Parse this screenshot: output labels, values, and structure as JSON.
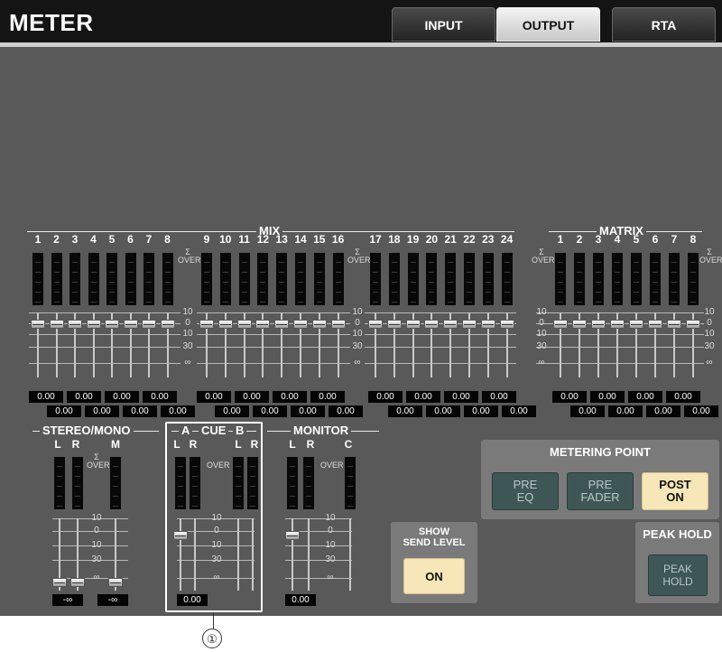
{
  "window": {
    "title": "METER"
  },
  "tabs": [
    {
      "label": "INPUT",
      "active": false
    },
    {
      "label": "OUTPUT",
      "active": true
    },
    {
      "label": "RTA",
      "active": false
    }
  ],
  "mix": {
    "title": "MIX",
    "channels": [
      "1",
      "2",
      "3",
      "4",
      "5",
      "6",
      "7",
      "8",
      "9",
      "10",
      "11",
      "12",
      "13",
      "14",
      "15",
      "16",
      "17",
      "18",
      "19",
      "20",
      "21",
      "22",
      "23",
      "24"
    ],
    "values_top": [
      "0.00",
      "0.00",
      "0.00",
      "0.00",
      "0.00",
      "0.00",
      "0.00",
      "0.00",
      "0.00",
      "0.00",
      "0.00",
      "0.00"
    ],
    "values_bottom": [
      "0.00",
      "0.00",
      "0.00",
      "0.00",
      "0.00",
      "0.00",
      "0.00",
      "0.00",
      "0.00",
      "0.00",
      "0.00",
      "0.00"
    ]
  },
  "matrix": {
    "title": "MATRIX",
    "channels": [
      "1",
      "2",
      "3",
      "4",
      "5",
      "6",
      "7",
      "8"
    ],
    "values_top": [
      "0.00",
      "0.00",
      "0.00",
      "0.00"
    ],
    "values_bottom": [
      "0.00",
      "0.00",
      "0.00",
      "0.00"
    ]
  },
  "scale": {
    "sigma": "Σ",
    "over": "OVER",
    "labels": [
      "10",
      "0",
      "10",
      "30",
      "∞"
    ]
  },
  "stereo_mono": {
    "title": "STEREO/MONO",
    "ch_l": "L",
    "ch_r": "R",
    "ch_m": "M",
    "values": [
      "-∞",
      "-∞"
    ]
  },
  "cue": {
    "title": "CUE",
    "a": "A",
    "b": "B",
    "ch_l": "L",
    "ch_r": "R",
    "value": "0.00"
  },
  "monitor": {
    "title": "MONITOR",
    "ch_l": "L",
    "ch_r": "R",
    "ch_c": "C",
    "value": "0.00"
  },
  "metering_point": {
    "title": "METERING POINT",
    "buttons": [
      {
        "line1": "PRE",
        "line2": "EQ",
        "state": "off"
      },
      {
        "line1": "PRE",
        "line2": "FADER",
        "state": "off"
      },
      {
        "line1": "POST",
        "line2": "ON",
        "state": "on"
      }
    ]
  },
  "show_send_level": {
    "line1": "SHOW",
    "line2": "SEND LEVEL",
    "button": "ON"
  },
  "peak_hold": {
    "title": "PEAK HOLD",
    "line1": "PEAK",
    "line2": "HOLD"
  },
  "callout": "①",
  "colors": {
    "background": "#595959",
    "titlebar": "#141414",
    "button_on": "#f6e6b8",
    "button_off": "#3e5756"
  }
}
